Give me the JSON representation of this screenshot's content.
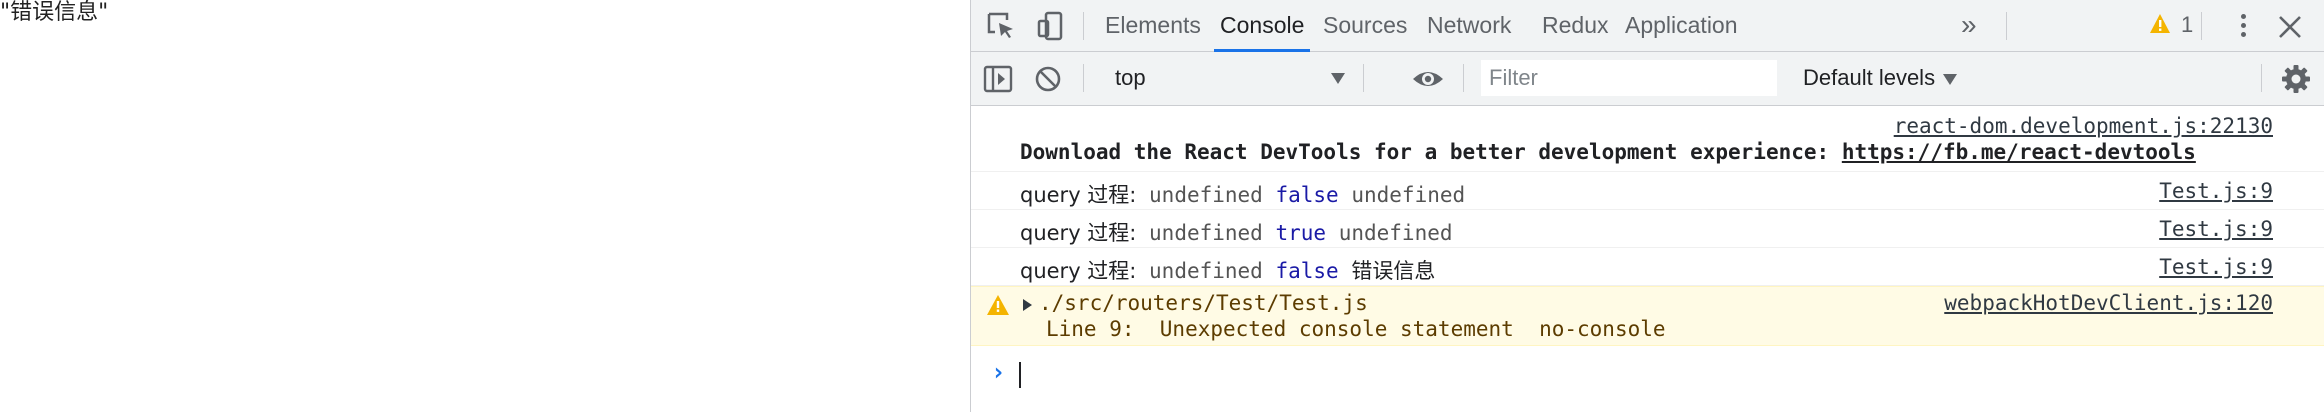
{
  "page": {
    "content_text": "\"错误信息\""
  },
  "devtools": {
    "tabs": [
      {
        "label": "Elements"
      },
      {
        "label": "Console"
      },
      {
        "label": "Sources"
      },
      {
        "label": "Network"
      },
      {
        "label": "Redux"
      },
      {
        "label": "Application"
      }
    ],
    "more_tabs_label": "»",
    "warning_count": "1",
    "toolbar": {
      "context": "top",
      "filter_placeholder": "Filter",
      "levels": "Default levels"
    },
    "console": {
      "devtools_msg": {
        "source": "react-dom.development.js:22130",
        "text": "Download the React DevTools for a better development experience: ",
        "link": "https://fb.me/react-devtools"
      },
      "logs": [
        {
          "prefix": "query 过程:",
          "a": "undefined",
          "b": "false",
          "c": "undefined",
          "source": "Test.js:9"
        },
        {
          "prefix": "query 过程:",
          "a": "undefined",
          "b": "true",
          "c": "undefined",
          "source": "Test.js:9"
        },
        {
          "prefix": "query 过程:",
          "a": "undefined",
          "b": "false",
          "c": "错误信息",
          "source": "Test.js:9"
        }
      ],
      "warning": {
        "path": "./src/routers/Test/Test.js",
        "detail": "Line 9:  Unexpected console statement  no-console",
        "source": "webpackHotDevClient.js:120"
      },
      "prompt_symbol": "›"
    },
    "colors": {
      "accent": "#1a73e8",
      "warning_bg": "#fffbe5",
      "warning_text": "#5c3c00",
      "keyword": "#1a1aa6"
    }
  }
}
